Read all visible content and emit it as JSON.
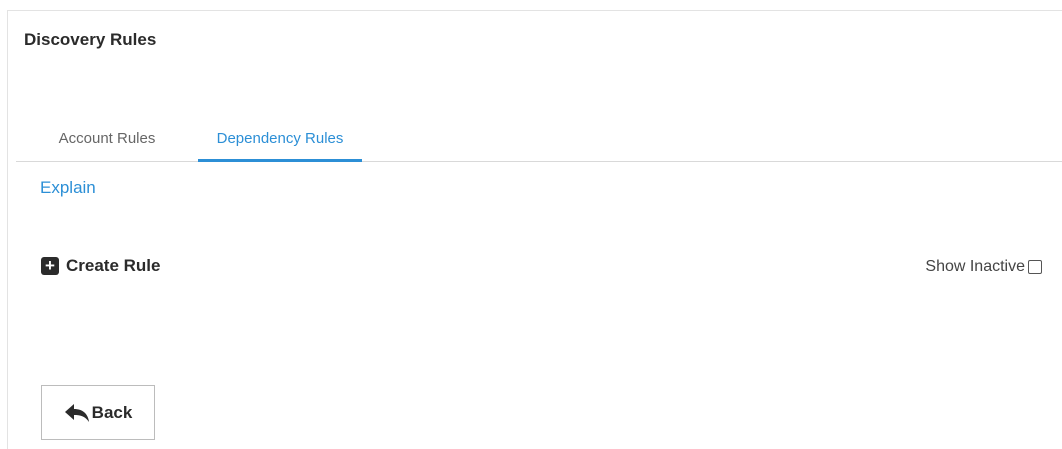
{
  "page": {
    "title": "Discovery Rules"
  },
  "tabs": [
    {
      "label": "Account Rules",
      "active": false
    },
    {
      "label": "Dependency Rules",
      "active": true
    }
  ],
  "explain_link": "Explain",
  "actions": {
    "create_rule_label": "Create Rule",
    "create_rule_icon": "plus-square-icon"
  },
  "filters": {
    "show_inactive_label": "Show Inactive",
    "show_inactive_checked": false
  },
  "footer": {
    "back_label": "Back",
    "back_icon": "reply-arrow-icon"
  },
  "colors": {
    "accent": "#2c8fd6",
    "text_dark": "#2b2b2b",
    "border": "#d9d9d9"
  }
}
